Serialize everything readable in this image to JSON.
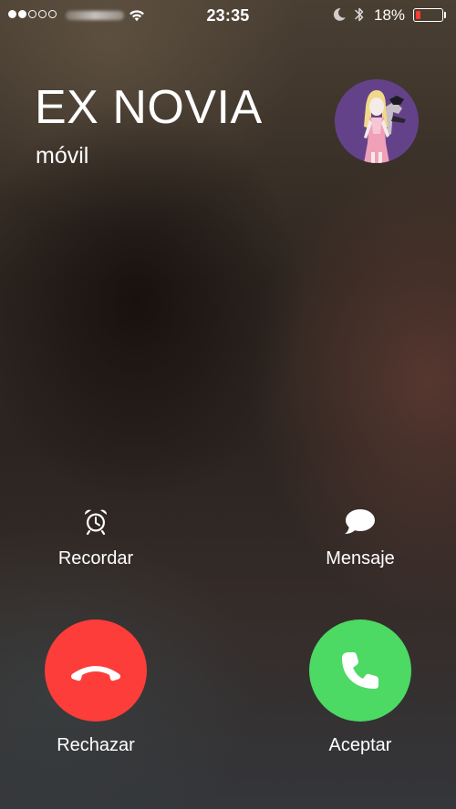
{
  "status_bar": {
    "signal_filled": 2,
    "signal_total": 5,
    "time": "23:35",
    "battery_percent": "18%",
    "battery_level": 0.18,
    "battery_color": "#ff3b30",
    "icons": [
      "wifi-icon",
      "moon-icon",
      "bluetooth-icon",
      "battery-icon"
    ]
  },
  "caller": {
    "name": "EX NOVIA",
    "label": "móvil"
  },
  "actions": {
    "remind": {
      "label": "Recordar",
      "icon": "alarm-clock-icon"
    },
    "message": {
      "label": "Mensaje",
      "icon": "speech-bubble-icon"
    }
  },
  "call_buttons": {
    "decline": {
      "label": "Rechazar",
      "color": "#fc3d39",
      "icon": "hang-up-icon"
    },
    "accept": {
      "label": "Aceptar",
      "color": "#4cd964",
      "icon": "phone-icon"
    }
  }
}
